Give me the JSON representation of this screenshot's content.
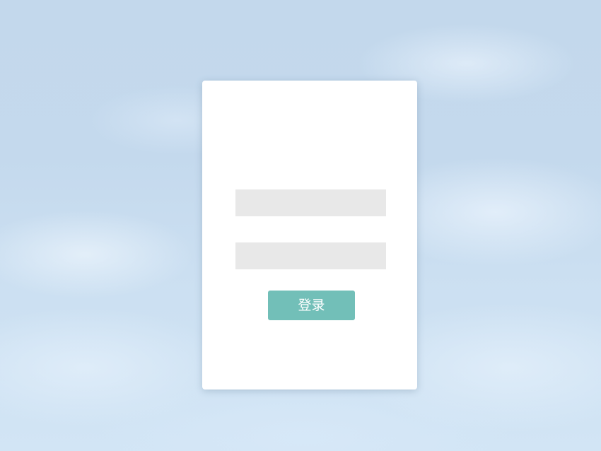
{
  "login_form": {
    "username_field": {
      "value": "",
      "placeholder": ""
    },
    "password_field": {
      "value": "",
      "placeholder": ""
    },
    "submit_label": "登录"
  },
  "colors": {
    "background": "#c6daed",
    "card": "#ffffff",
    "field": "#e8e8e8",
    "button": "#72bfb8",
    "button_text": "#ffffff"
  }
}
